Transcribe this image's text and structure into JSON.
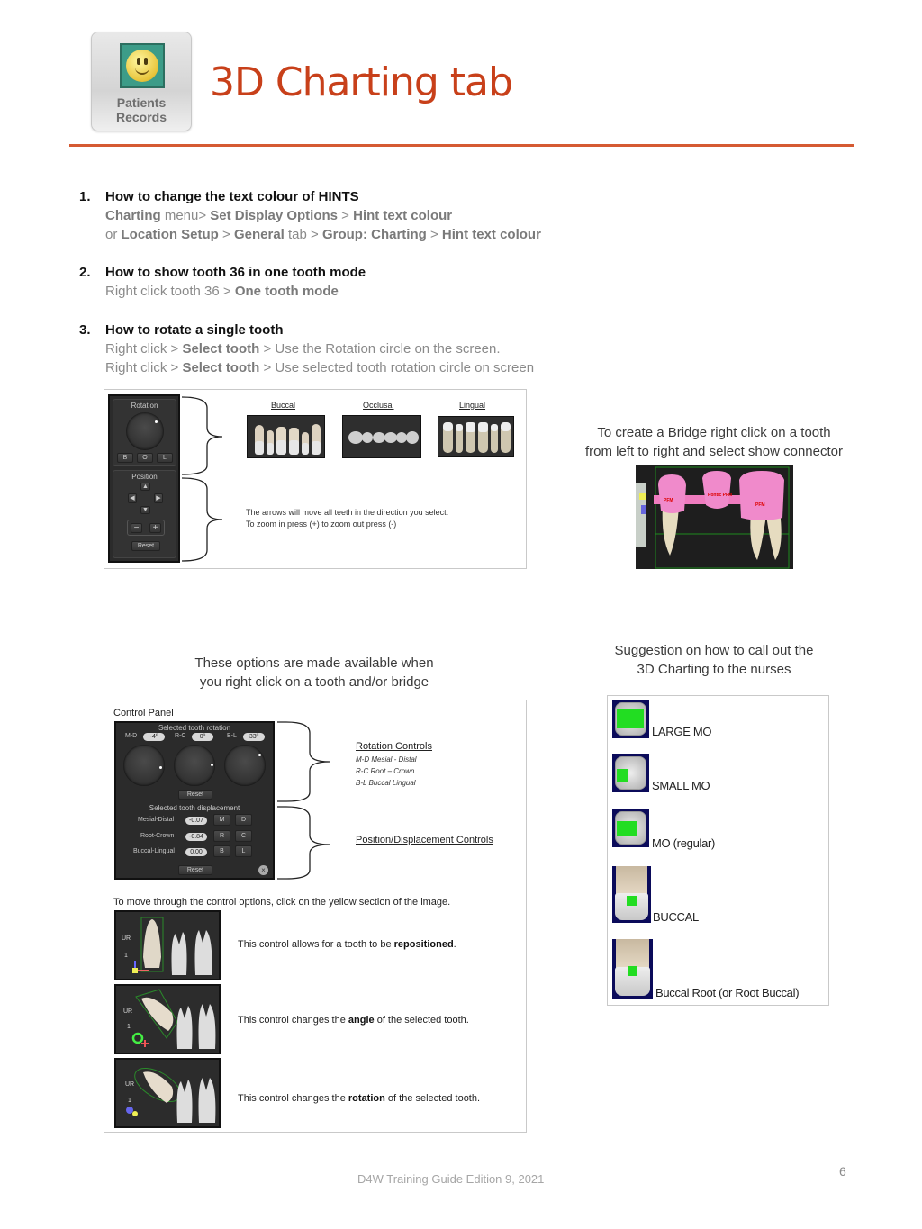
{
  "header": {
    "app_icon_label_line1": "Patients",
    "app_icon_label_line2": "Records",
    "title": "3D Charting tab",
    "accent_color": "#c8401a"
  },
  "items": [
    {
      "number": "1.",
      "heading": "How to change the text colour of HINTS",
      "lines": [
        [
          {
            "t": "Charting",
            "b": true
          },
          {
            "t": " menu> ",
            "b": false
          },
          {
            "t": "Set Display Options",
            "b": true
          },
          {
            "t": " > ",
            "b": false
          },
          {
            "t": "Hint text colour",
            "b": true
          }
        ],
        [
          {
            "t": "or ",
            "b": false
          },
          {
            "t": "Location Setup",
            "b": true
          },
          {
            "t": " > ",
            "b": false
          },
          {
            "t": "General",
            "b": true
          },
          {
            "t": " tab > ",
            "b": false
          },
          {
            "t": "Group: Charting",
            "b": true
          },
          {
            "t": " > ",
            "b": false
          },
          {
            "t": "Hint text colour",
            "b": true
          }
        ]
      ]
    },
    {
      "number": "2.",
      "heading": "How to show tooth 36 in one tooth mode",
      "lines": [
        [
          {
            "t": "Right click tooth 36 > ",
            "b": false
          },
          {
            "t": "One tooth mode",
            "b": true
          }
        ]
      ]
    },
    {
      "number": "3.",
      "heading": "How to rotate a single tooth",
      "lines": [
        [
          {
            "t": "Right click > ",
            "b": false
          },
          {
            "t": "Select tooth",
            "b": true
          },
          {
            "t": " > Use the Rotation circle on the screen.",
            "b": false
          }
        ],
        [
          {
            "t": "Right click > ",
            "b": false
          },
          {
            "t": "Select tooth",
            "b": true
          },
          {
            "t": " > Use selected tooth rotation circle on screen",
            "b": false
          }
        ]
      ]
    }
  ],
  "rotation_panel": {
    "rotation_label": "Rotation",
    "view_buttons": [
      "B",
      "O",
      "L"
    ],
    "position_label": "Position",
    "zoom_out": "−",
    "zoom_in": "+",
    "reset_label": "Reset",
    "views": [
      "Buccal",
      "Occlusal",
      "Lingual"
    ],
    "note_line1": "The arrows will move all teeth in the direction you select.",
    "note_line2": "To zoom in press (+) to zoom out press (-)"
  },
  "bridge": {
    "caption_line1": "To create a Bridge right click on a tooth",
    "caption_line2": "from left to right and select show connector",
    "labels": [
      "PFM",
      "Pontic PFM",
      "PFM"
    ]
  },
  "control_panel_section": {
    "intro_line1": "These options are made available when",
    "intro_line2": "you right click on a tooth and/or bridge",
    "panel_title": "Control Panel",
    "rotation_header": "Selected tooth rotation",
    "rotation_axes": [
      {
        "label": "M-D",
        "value": "-4º"
      },
      {
        "label": "R-C",
        "value": "0º"
      },
      {
        "label": "B-L",
        "value": "33º"
      }
    ],
    "reset_label": "Reset",
    "displacement_header": "Selected tooth displacement",
    "displacement_rows": [
      {
        "label": "Mesial-Distal",
        "value": "-0.07",
        "btn1": "M",
        "btn2": "D"
      },
      {
        "label": "Root-Crown",
        "value": "-0.84",
        "btn1": "R",
        "btn2": "C"
      },
      {
        "label": "Buccal-Lingual",
        "value": "0.00",
        "btn1": "B",
        "btn2": "L"
      }
    ],
    "rotation_controls_heading": "Rotation Controls",
    "rotation_controls_lines": [
      "M-D  Mesial - Distal",
      "R-C   Root – Crown",
      "B-L   Buccal Lingual"
    ],
    "position_controls_heading": "Position/Displacement Controls",
    "move_note": "To move through the control options, click on the yellow section of the image.",
    "tooth_label": "UR",
    "tooth_number": "1",
    "controls": [
      {
        "pre": "This control allows for a tooth to be ",
        "bold": "repositioned",
        "post": "."
      },
      {
        "pre": "This control changes the ",
        "bold": "angle",
        "post": " of the selected tooth."
      },
      {
        "pre": "This control changes the ",
        "bold": "rotation",
        "post": " of the selected tooth."
      }
    ]
  },
  "suggestion": {
    "caption_line1": "Suggestion on how to call out the",
    "caption_line2": "3D Charting to the nurses",
    "entries": [
      "LARGE MO",
      "SMALL MO",
      "MO (regular)",
      "BUCCAL",
      "Buccal Root (or Root Buccal)"
    ]
  },
  "footer": {
    "text": "D4W Training Guide Edition 9, 2021",
    "page_number": "6"
  }
}
